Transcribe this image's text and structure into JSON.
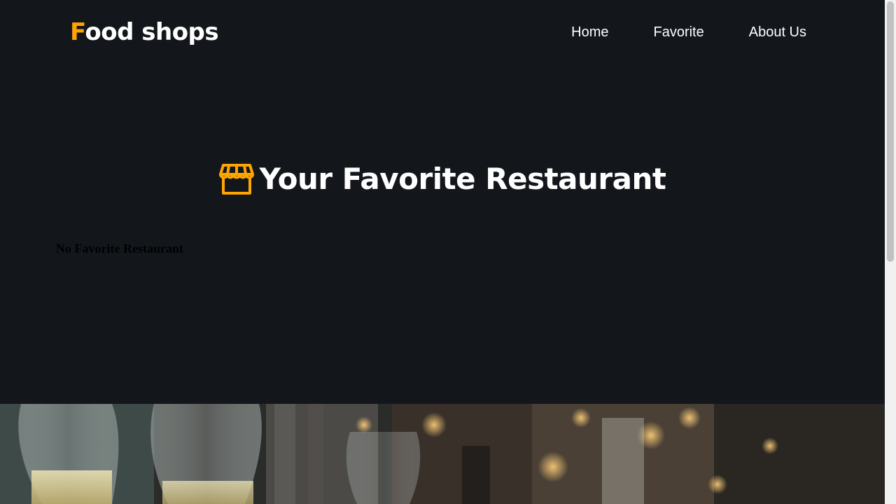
{
  "header": {
    "logo_first": "F",
    "logo_rest": "ood shops",
    "nav": {
      "home": "Home",
      "favorite": "Favorite",
      "about": "About Us"
    }
  },
  "main": {
    "title": "Your Favorite Restaurant",
    "title_icon": "store-icon",
    "empty_message": "No Favorite Restaurant"
  },
  "colors": {
    "background": "#13171c",
    "accent": "#ffa500",
    "text": "#ffffff"
  },
  "footer": {
    "image": "restaurant-glasses-photo"
  }
}
